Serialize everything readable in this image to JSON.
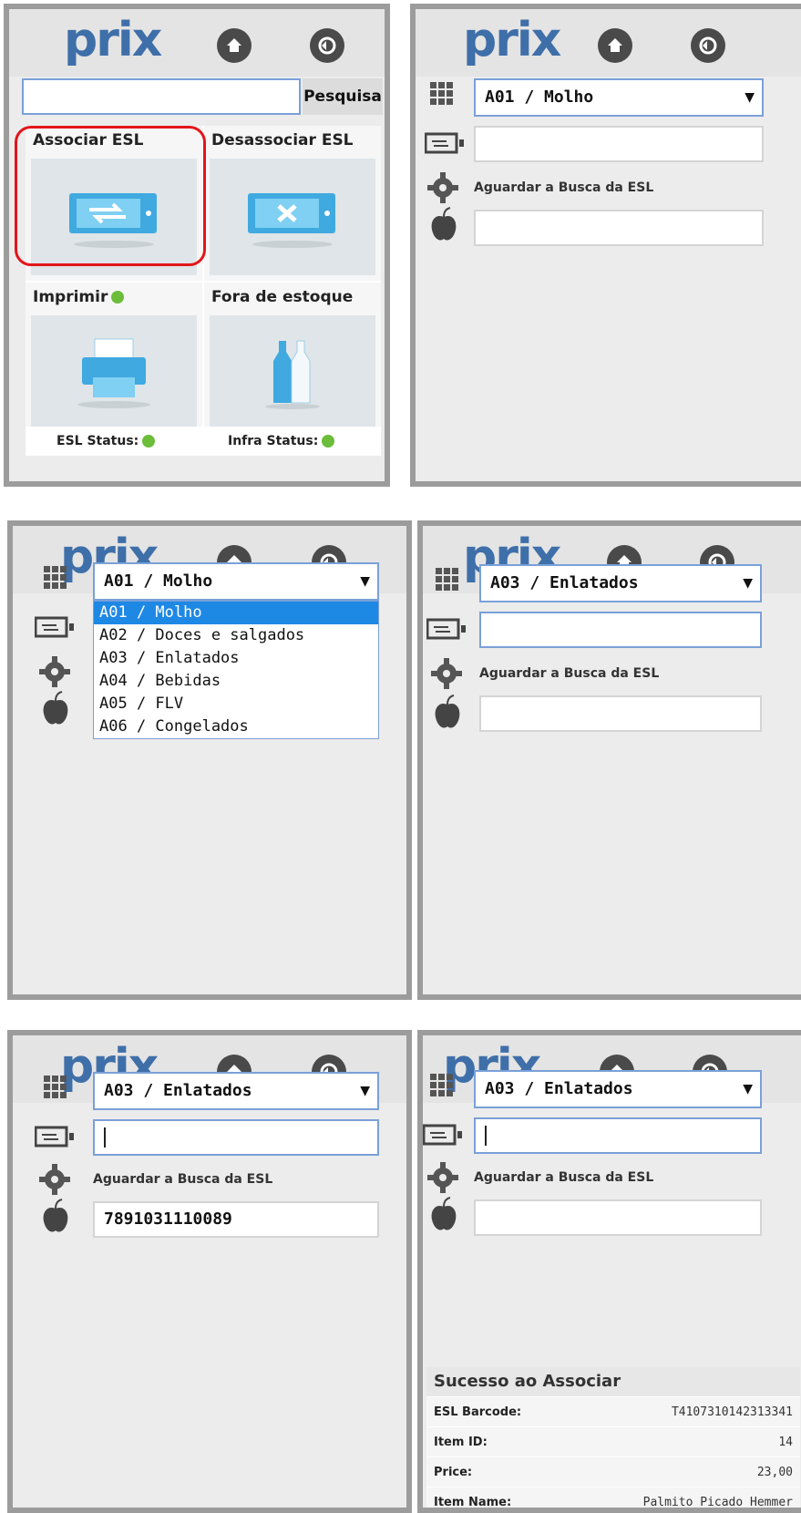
{
  "app": {
    "logo": "prix"
  },
  "home_screen": {
    "search_button": "Pesquisa",
    "tiles": [
      {
        "label": "Associar ESL",
        "icon": "associate-esl-icon"
      },
      {
        "label": "Desassociar ESL",
        "icon": "disassociate-esl-icon"
      },
      {
        "label": "Imprimir",
        "icon": "printer-icon"
      },
      {
        "label": "Fora de estoque",
        "icon": "bottles-icon"
      }
    ],
    "esl_status": "ESL Status:",
    "infra_status": "Infra Status:",
    "status_color": "#6bbd3a",
    "highlight_color": "#e3151a"
  },
  "associate_screens": {
    "await_text": "Aguardar a Busca da ESL",
    "selected_initial": "A01 / Molho",
    "selected_after": "A03 / Enlatados",
    "item_barcode": "7891031110089"
  },
  "dropdown_options": [
    "A01 / Molho",
    "A02 / Doces e salgados",
    "A03 / Enlatados",
    "A04 / Bebidas",
    "A05 / FLV",
    "A06 / Congelados"
  ],
  "result": {
    "title": "Sucesso ao Associar",
    "rows": [
      {
        "key": "ESL Barcode:",
        "value": "T4107310142313341"
      },
      {
        "key": "Item ID:",
        "value": "14"
      },
      {
        "key": "Price:",
        "value": "23,00"
      },
      {
        "key": "Item Name:",
        "value": "Palmito Picado Hemmer"
      }
    ]
  },
  "colors": {
    "accent": "#3f6fa9",
    "selection": "#1e88e5",
    "border": "#9c9c9c"
  }
}
